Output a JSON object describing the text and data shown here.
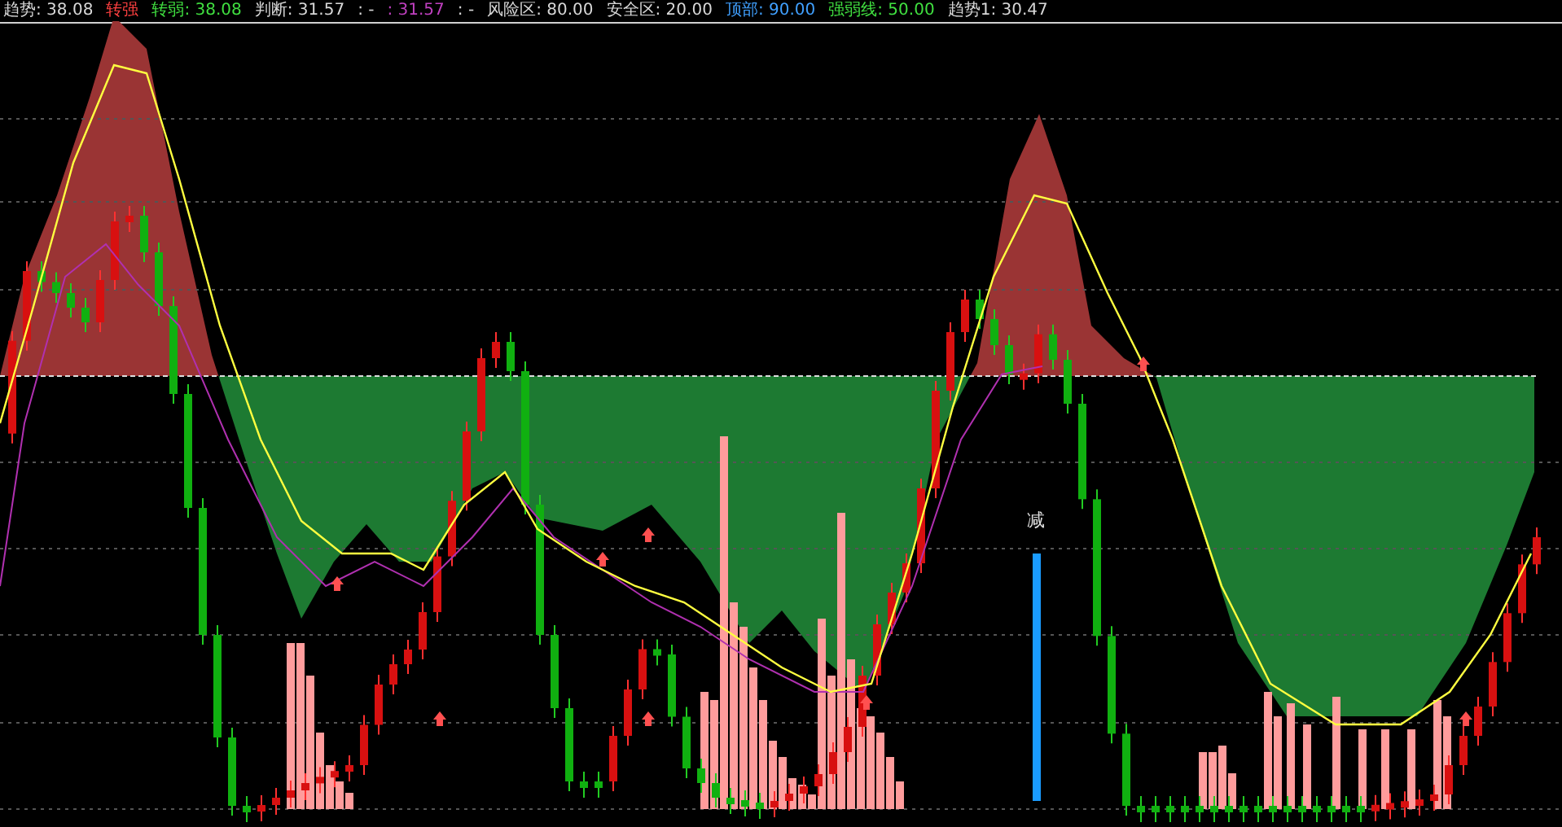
{
  "legend": [
    {
      "label": "趋势",
      "value": ": 38.08",
      "kind": "plain"
    },
    {
      "label": "转强",
      "kind": "up"
    },
    {
      "label": "转弱",
      "value": ": 38.08",
      "kind": "down"
    },
    {
      "label": "判断",
      "value": ": 31.57",
      "kind": "plain"
    },
    {
      "value": ": -",
      "kind": "plain"
    },
    {
      "value": ": 31.57",
      "kind": "purple"
    },
    {
      "value": ": -",
      "kind": "plain"
    },
    {
      "label": "风险区",
      "value": ": 80.00",
      "kind": "plain"
    },
    {
      "label": "安全区",
      "value": ": 20.00",
      "kind": "plain"
    },
    {
      "label": "顶部",
      "value": ": 90.00",
      "kind": "blue"
    },
    {
      "label": "强弱线",
      "value": ": 50.00",
      "kind": "green"
    },
    {
      "label": "趋势1",
      "value": ": 30.47",
      "kind": "plain"
    }
  ],
  "chart": {
    "signal_label": "减"
  }
}
